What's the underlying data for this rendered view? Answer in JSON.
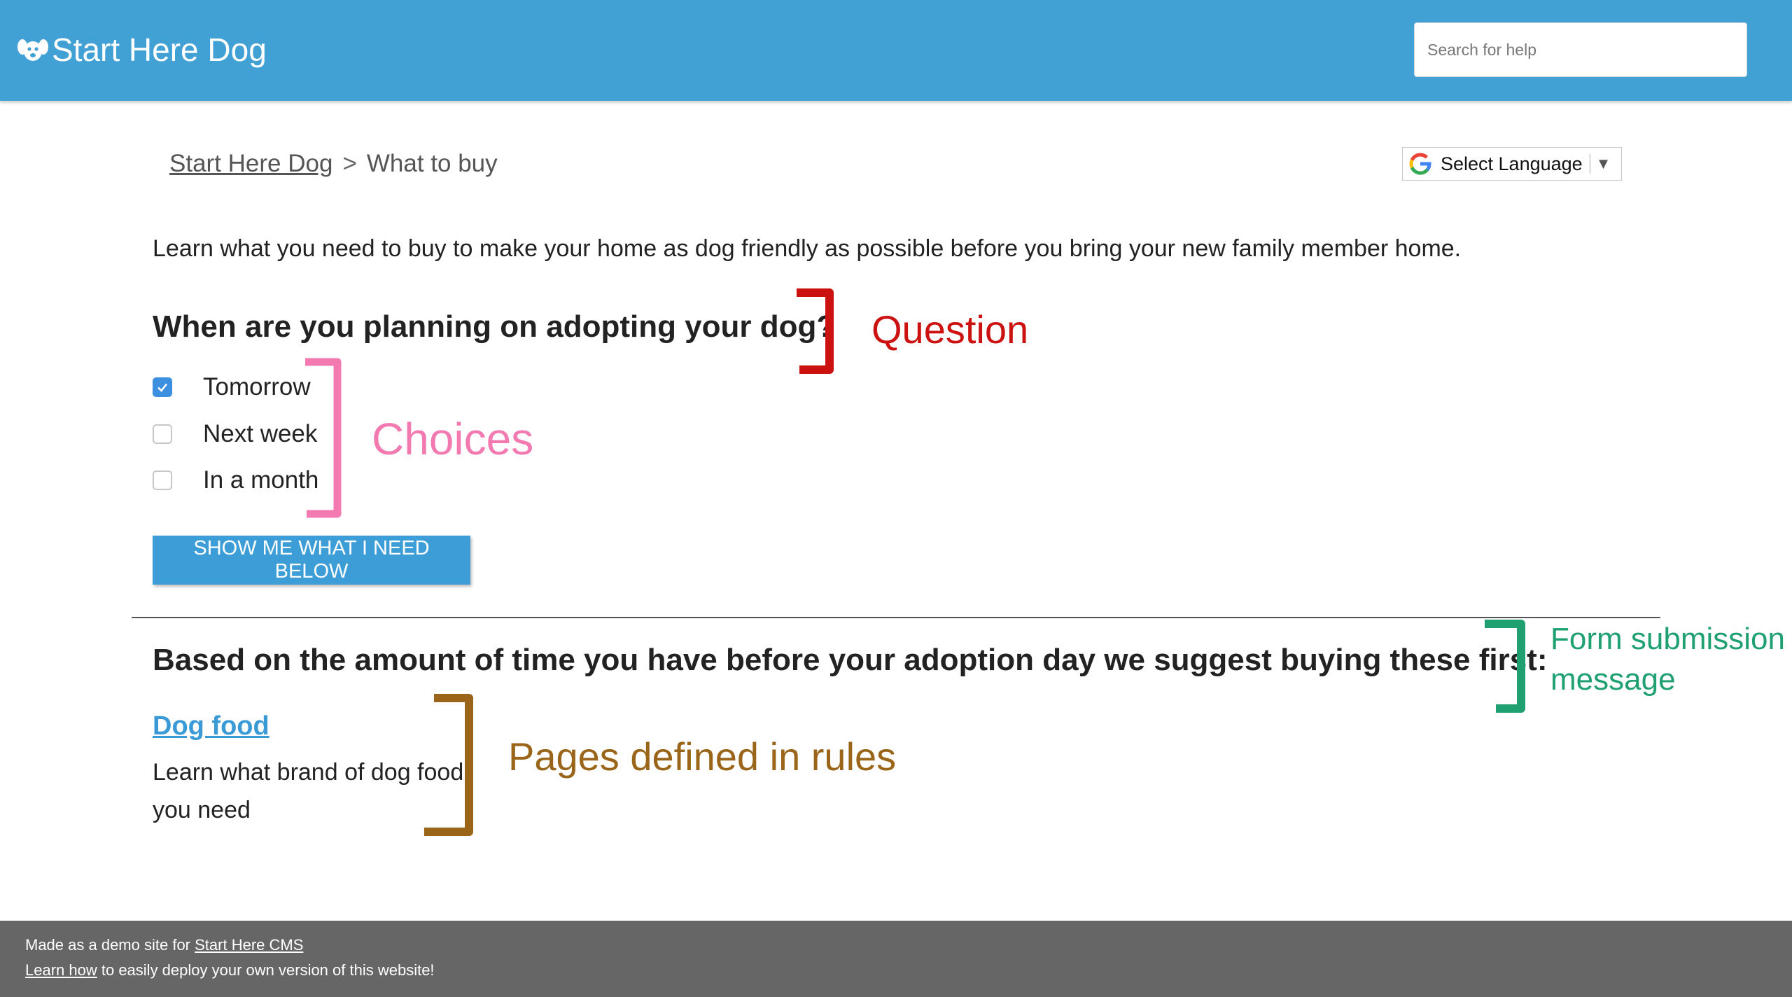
{
  "header": {
    "brand": "Start Here Dog",
    "brand_icon": "dog-face-icon",
    "search_placeholder": "Search for help"
  },
  "breadcrumb": {
    "home": "Start Here Dog",
    "separator": ">",
    "current": "What to buy"
  },
  "language_select": {
    "label": "Select Language",
    "icon": "google-g-icon",
    "caret": "▼"
  },
  "main": {
    "intro": "Learn what you need to buy to make your home as dog friendly as possible before you bring your new family member home.",
    "question": "When are you planning on adopting your dog?",
    "choices": [
      {
        "label": "Tomorrow",
        "checked": true
      },
      {
        "label": "Next week",
        "checked": false
      },
      {
        "label": "In a month",
        "checked": false
      }
    ],
    "submit_label": "Show me what I need below",
    "result_heading": "Based on the amount of time you have before your adoption day we suggest buying these first:",
    "result_pages": [
      {
        "title": "Dog food",
        "description": "Learn what brand of dog food you need"
      }
    ]
  },
  "annotations": {
    "question": {
      "label": "Question",
      "color": "#cc1111"
    },
    "choices": {
      "label": "Choices",
      "color": "#f27ab0"
    },
    "form_message": {
      "label_line1": "Form submission",
      "label_line2": "message",
      "color": "#1fa071"
    },
    "pages": {
      "label": "Pages defined in rules",
      "color": "#9a6519"
    }
  },
  "footer": {
    "line1_text": "Made as a demo site for ",
    "line1_link": "Start Here CMS",
    "line2_link": "Learn how",
    "line2_text": " to easily deploy your own version of this website!"
  },
  "colors": {
    "header_bg": "#41a0d4",
    "button_bg": "#3d9dd6",
    "link": "#3a9ad6",
    "footer_bg": "#666666"
  }
}
